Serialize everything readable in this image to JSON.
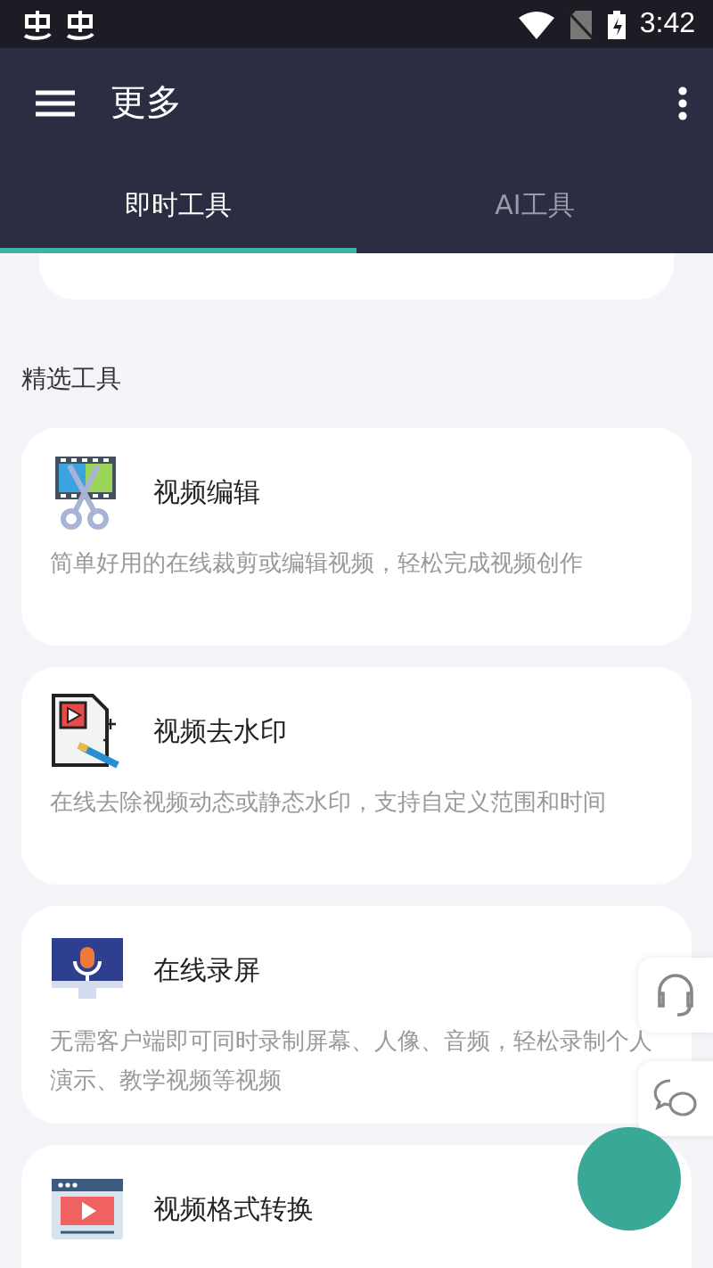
{
  "status_bar": {
    "time": "3:42"
  },
  "app_bar": {
    "title": "更多"
  },
  "tabs": [
    {
      "label": "即时工具",
      "selected": true
    },
    {
      "label": "AI工具",
      "selected": false
    }
  ],
  "section_title": "精选工具",
  "tools": [
    {
      "kind": "edit",
      "name": "视频编辑",
      "description": "简单好用的在线裁剪或编辑视频，轻松完成视频创作"
    },
    {
      "kind": "watermark",
      "name": "视频去水印",
      "description": "在线去除视频动态或静态水印，支持自定义范围和时间"
    },
    {
      "kind": "record",
      "name": "在线录屏",
      "description": "无需客户端即可同时录制屏幕、人像、音频，轻松录制个人演示、教学视频等视频"
    },
    {
      "kind": "convert",
      "name": "视频格式转换"
    }
  ]
}
